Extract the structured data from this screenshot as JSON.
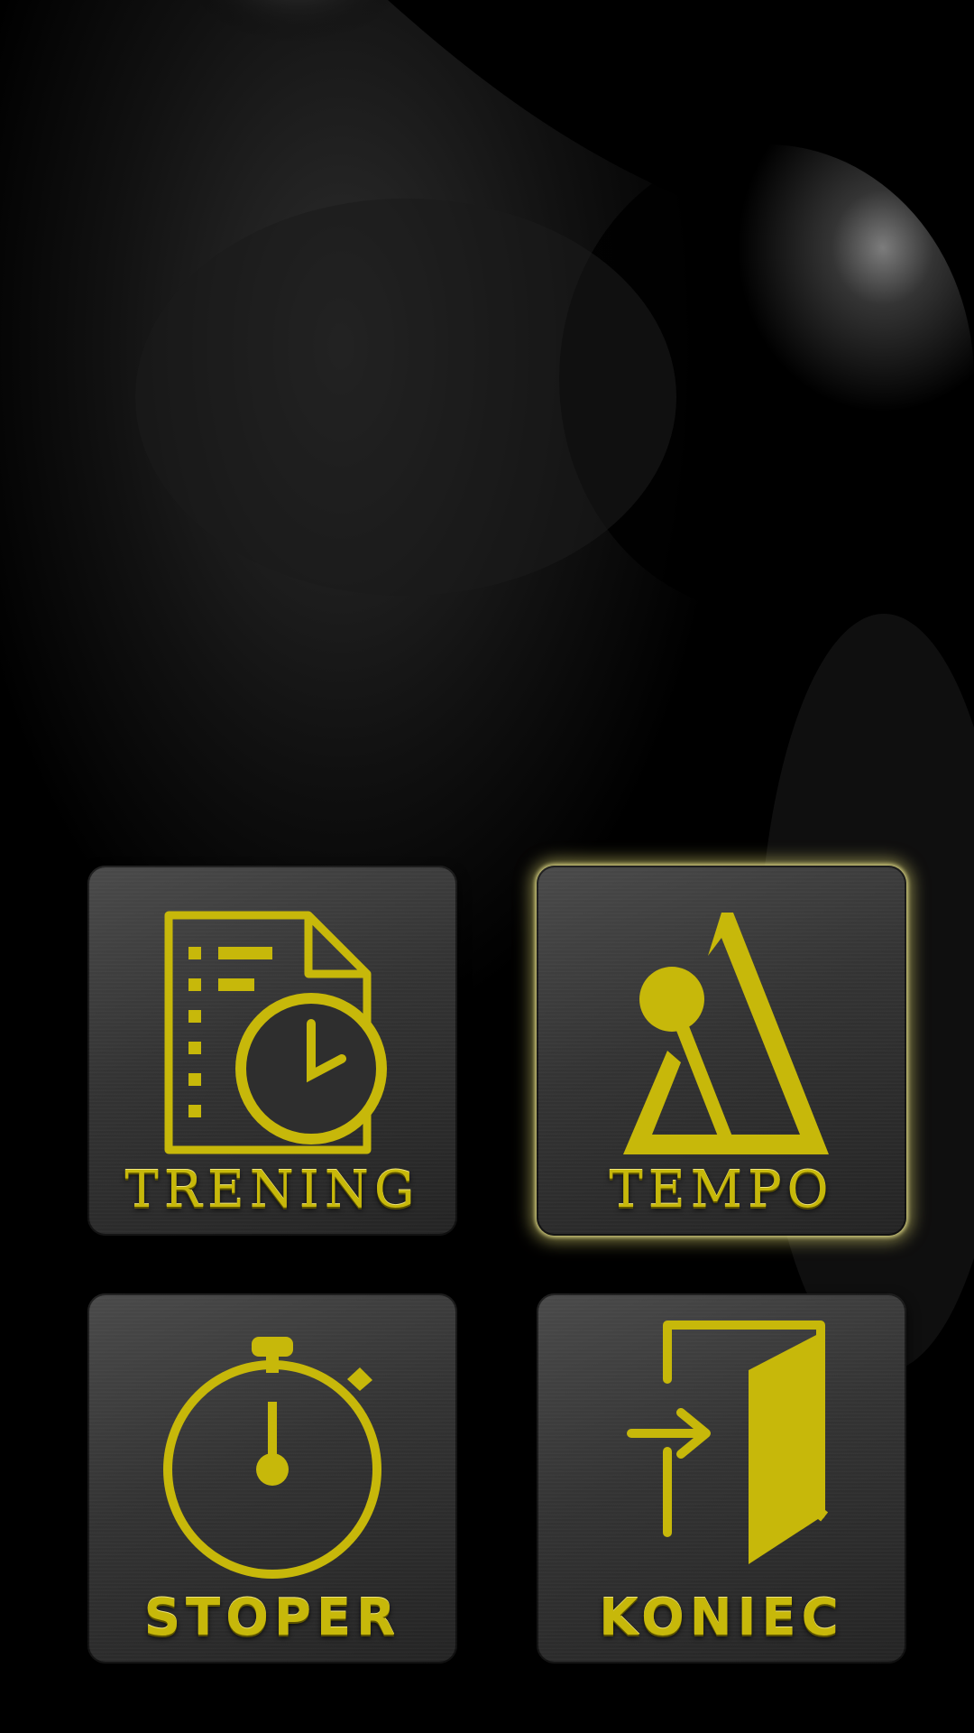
{
  "menu": {
    "trening": {
      "label": "TRENING",
      "icon": "training-plan-icon"
    },
    "tempo": {
      "label": "TEMPO",
      "icon": "metronome-icon",
      "active": true
    },
    "stoper": {
      "label": "STOPER",
      "icon": "stopwatch-icon"
    },
    "koniec": {
      "label": "KONIEC",
      "icon": "exit-door-icon"
    }
  },
  "colors": {
    "accent": "#c7b80a",
    "tile": "#3a3a3a",
    "background": "#000000"
  }
}
